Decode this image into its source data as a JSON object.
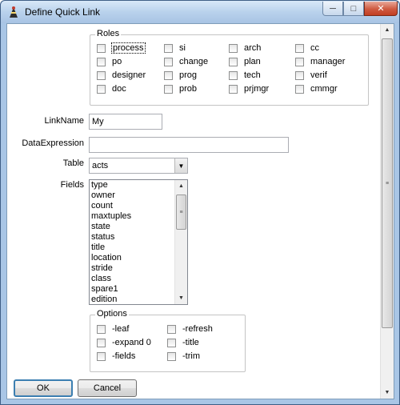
{
  "window": {
    "title": "Define Quick Link",
    "minimize_glyph": "─",
    "maximize_glyph": "□",
    "close_glyph": "✕"
  },
  "roles": {
    "legend": "Roles",
    "items": [
      {
        "label": "process"
      },
      {
        "label": "si"
      },
      {
        "label": "arch"
      },
      {
        "label": "cc"
      },
      {
        "label": "po"
      },
      {
        "label": "change"
      },
      {
        "label": "plan"
      },
      {
        "label": "manager"
      },
      {
        "label": "designer"
      },
      {
        "label": "prog"
      },
      {
        "label": "tech"
      },
      {
        "label": "verif"
      },
      {
        "label": "doc"
      },
      {
        "label": "prob"
      },
      {
        "label": "prjmgr"
      },
      {
        "label": "cmmgr"
      }
    ]
  },
  "form": {
    "linkname_label": "LinkName",
    "linkname_value": "My",
    "dataexpression_label": "DataExpression",
    "dataexpression_value": "",
    "table_label": "Table",
    "table_value": "acts",
    "fields_label": "Fields"
  },
  "fields": [
    "type",
    "owner",
    "count",
    "maxtuples",
    "state",
    "status",
    "title",
    "location",
    "stride",
    "class",
    "spare1",
    "edition"
  ],
  "options": {
    "legend": "Options",
    "items": [
      {
        "label": "-leaf"
      },
      {
        "label": "-refresh"
      },
      {
        "label": "-expand 0"
      },
      {
        "label": "-title"
      },
      {
        "label": "-fields"
      },
      {
        "label": "-trim"
      }
    ]
  },
  "buttons": {
    "ok": "OK",
    "cancel": "Cancel"
  },
  "icons": {
    "app": "quill-icon",
    "scroll_up": "▲",
    "scroll_down": "▼",
    "scroll_grip": "≡",
    "combo_arrow": "▼"
  }
}
